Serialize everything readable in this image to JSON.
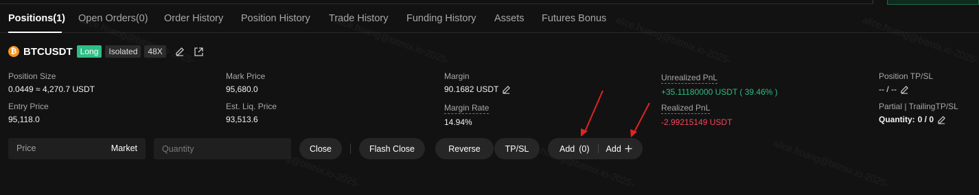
{
  "tabs": [
    {
      "label": "Positions(1)",
      "active": true
    },
    {
      "label": "Open Orders(0)"
    },
    {
      "label": "Order History"
    },
    {
      "label": "Position History"
    },
    {
      "label": "Trade History"
    },
    {
      "label": "Funding History"
    },
    {
      "label": "Assets"
    },
    {
      "label": "Futures Bonus"
    }
  ],
  "position": {
    "coin_glyph": "₿",
    "symbol": "BTCUSDT",
    "side": "Long",
    "margin_mode": "Isolated",
    "leverage": "48X"
  },
  "fields": {
    "position_size": {
      "label": "Position Size",
      "value": "0.0449 ≈ 4,270.7 USDT"
    },
    "entry_price": {
      "label": "Entry Price",
      "value": "95,118.0"
    },
    "mark_price": {
      "label": "Mark Price",
      "value": "95,680.0"
    },
    "est_liq_price": {
      "label": "Est. Liq. Price",
      "value": "93,513.6"
    },
    "margin": {
      "label": "Margin",
      "value": "90.1682 USDT"
    },
    "margin_rate": {
      "label": "Margin Rate",
      "value": "14.94%"
    },
    "unrealized_pnl": {
      "label": "Unrealized PnL",
      "value": "+35.11180000 USDT ( 39.46% )"
    },
    "realized_pnl": {
      "label": "Realized PnL",
      "value": "-2.99215149 USDT"
    },
    "position_tpsl": {
      "label": "Position TP/SL",
      "value": "-- / --"
    },
    "partial_trailing": {
      "label": "Partial | TrailingTP/SL",
      "value_label": "Quantity:",
      "value": "0 / 0"
    }
  },
  "controls": {
    "price_placeholder": "Price",
    "price_mode": "Market",
    "quantity_placeholder": "Quantity",
    "close": "Close",
    "flash_close": "Flash Close",
    "reverse": "Reverse",
    "tpsl": "TP/SL",
    "add_label": "Add",
    "add_count": "(0)",
    "add2_label": "Add"
  },
  "colors": {
    "background": "#121212",
    "long": "#2ebd85",
    "profit": "#2ebd85",
    "loss": "#f6465d",
    "btc": "#f7931a",
    "annotation_arrow": "#e02424"
  },
  "icons": [
    "bitcoin-icon",
    "edit-icon",
    "share-icon",
    "pencil-icon",
    "plus-icon"
  ],
  "watermark": "alice.huang@bitmix.io-2025-"
}
